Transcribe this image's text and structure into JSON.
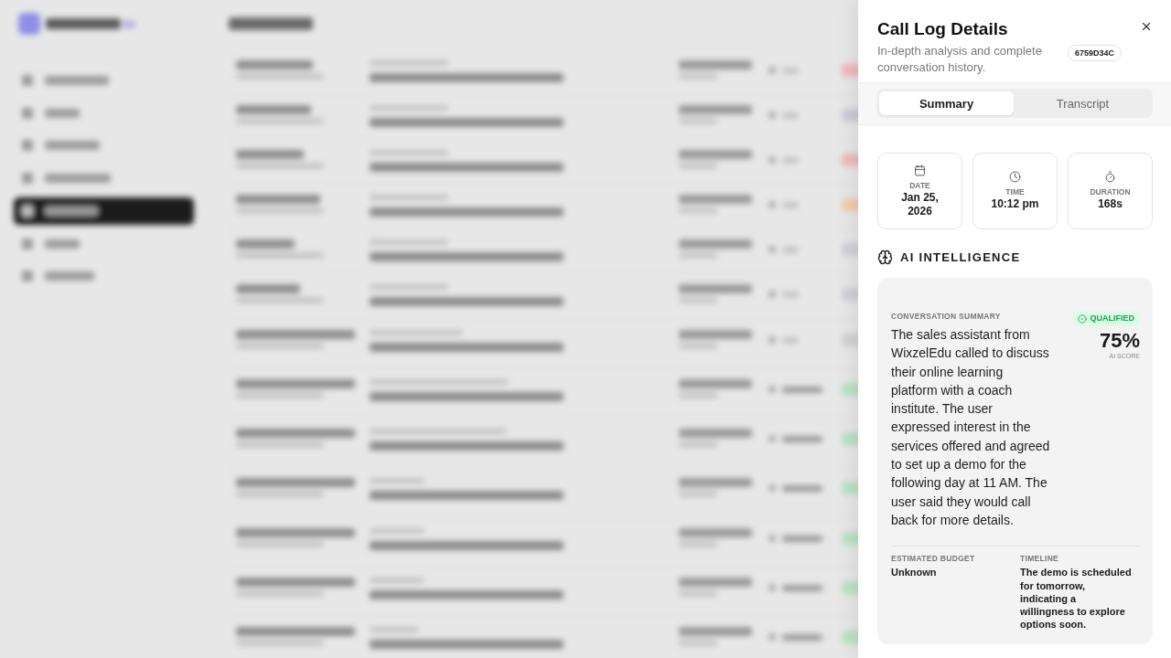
{
  "panel": {
    "title": "Call Log Details",
    "subtitle": "In-depth analysis and complete conversation history.",
    "id_badge": "6759D34C"
  },
  "tabs": [
    {
      "label": "Summary",
      "selected": true
    },
    {
      "label": "Transcript",
      "selected": false
    }
  ],
  "stats": [
    {
      "kind": "date",
      "label": "DATE",
      "value": "Jan 25, 2026"
    },
    {
      "kind": "time",
      "label": "TIME",
      "value": "10:12 pm"
    },
    {
      "kind": "duration",
      "label": "DURATION",
      "value": "168s"
    }
  ],
  "ai_intelligence": {
    "heading": "AI INTELLIGENCE",
    "summary_label": "CONVERSATION SUMMARY",
    "summary": "The sales assistant from WixzelEdu called to discuss their online learning platform with a coach institute. The user expressed interest in the services offered and agreed to set up a demo for the following day at 11 AM. The user said they would call back for more details.",
    "status": {
      "label": "QUALIFIED",
      "qualified": true
    },
    "score": "75%",
    "score_label": "AI SCORE",
    "details": [
      {
        "label": "ESTIMATED BUDGET",
        "value": "Unknown"
      },
      {
        "label": "TIMELINE",
        "value": "The demo is scheduled for tomorrow, indicating a willingness to explore options soon."
      }
    ]
  }
}
